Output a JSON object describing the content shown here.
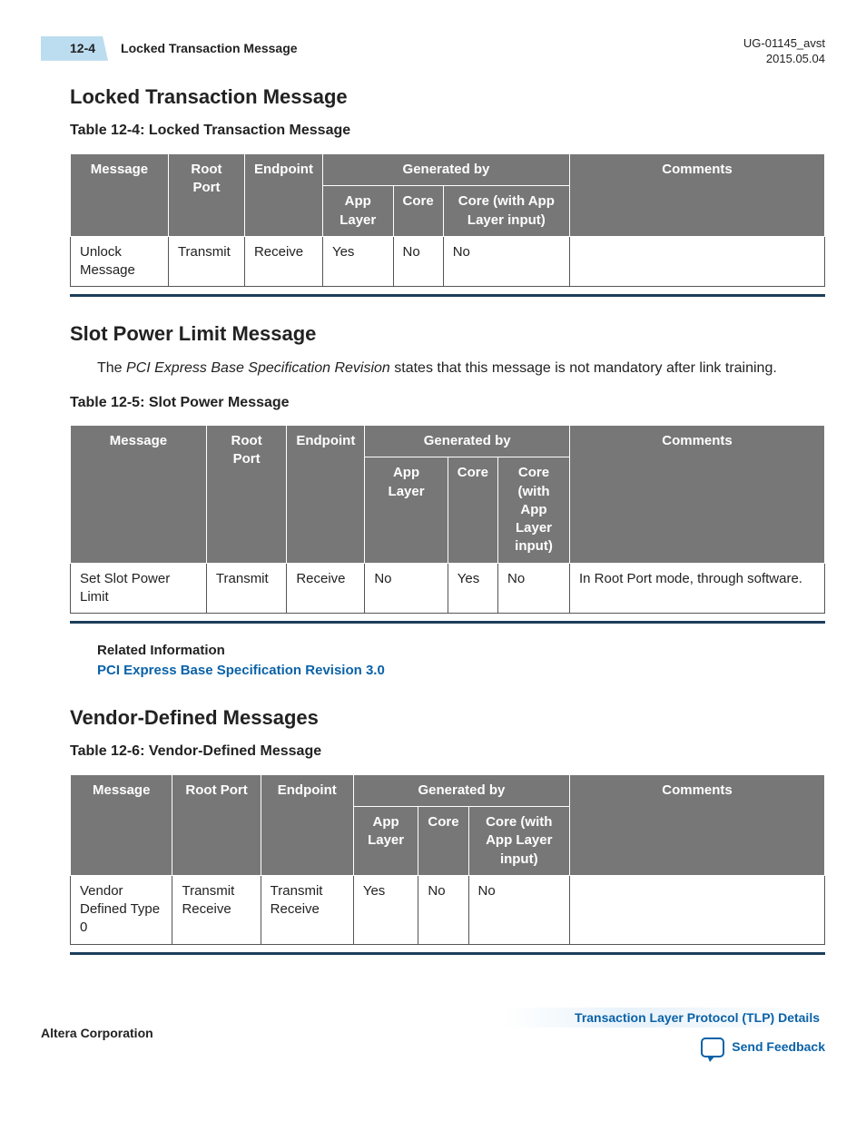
{
  "header": {
    "page_num": "12-4",
    "page_title": "Locked Transaction Message",
    "doc_id": "UG-01145_avst",
    "doc_date": "2015.05.04"
  },
  "section1": {
    "heading": "Locked Transaction Message",
    "table_caption": "Table 12-4: Locked Transaction Message",
    "headers": {
      "message": "Message",
      "root_port": "Root Port",
      "endpoint": "Endpoint",
      "gen_by": "Generated by",
      "app_layer": "App Layer",
      "core": "Core",
      "core_app": "Core (with App Layer input)",
      "comments": "Comments"
    },
    "row": {
      "message": "Unlock Message",
      "root_port": "Transmit",
      "endpoint": "Receive",
      "app_layer": "Yes",
      "core": "No",
      "core_app": "No",
      "comments": ""
    }
  },
  "section2": {
    "heading": "Slot Power Limit Message",
    "para_pre": "The ",
    "para_em": "PCI Express Base Specification Revision",
    "para_post": " states that this message is not mandatory after link training.",
    "table_caption": "Table 12-5: Slot Power Message",
    "headers": {
      "message": "Message",
      "root_port": "Root Port",
      "endpoint": "Endpoint",
      "gen_by": "Generated by",
      "app_layer": "App Layer",
      "core": "Core",
      "core_app": "Core (with App Layer input)",
      "comments": "Comments"
    },
    "row": {
      "message": "Set Slot Power Limit",
      "root_port": "Transmit",
      "endpoint": "Receive",
      "app_layer": "No",
      "core": "Yes",
      "core_app": "No",
      "comments": "In Root Port mode, through software."
    },
    "related_title": "Related Information",
    "related_link": "PCI Express Base Specification Revision 3.0"
  },
  "section3": {
    "heading": "Vendor-Defined Messages",
    "table_caption": "Table 12-6: Vendor-Defined Message",
    "headers": {
      "message": "Message",
      "root_port": "Root Port",
      "endpoint": "Endpoint",
      "gen_by": "Generated by",
      "app_layer": "App Layer",
      "core": "Core",
      "core_app": "Core (with App Layer input)",
      "comments": "Comments"
    },
    "row": {
      "message": "Vendor Defined Type 0",
      "root_port": "Transmit Receive",
      "endpoint": "Transmit Receive",
      "app_layer": "Yes",
      "core": "No",
      "core_app": "No",
      "comments": ""
    }
  },
  "footer": {
    "corp": "Altera Corporation",
    "right_link": "Transaction Layer Protocol (TLP) Details",
    "feedback": "Send Feedback"
  }
}
